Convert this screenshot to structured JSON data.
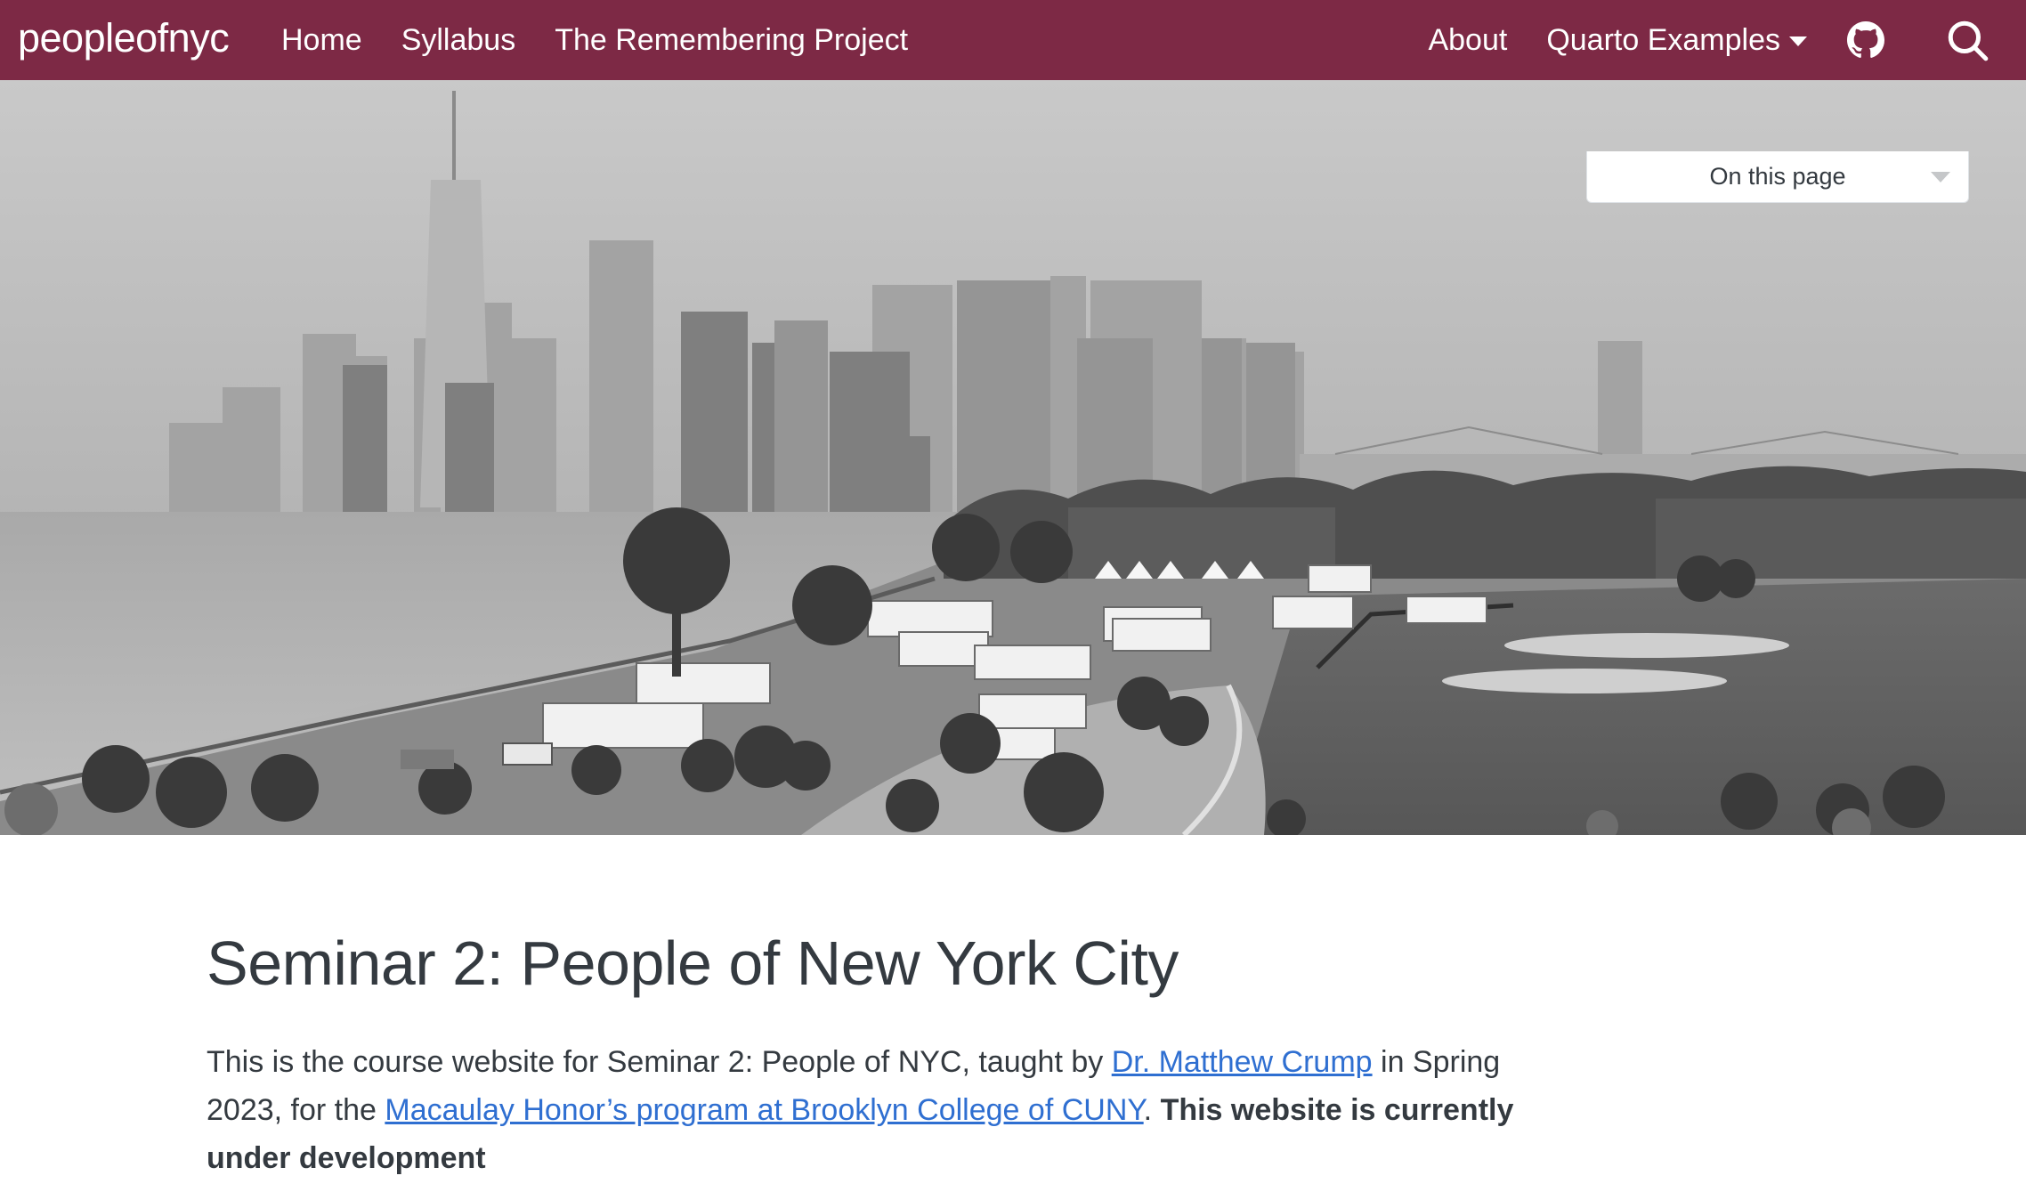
{
  "navbar": {
    "brand": "peopleofnyc",
    "left_links": [
      {
        "label": "Home"
      },
      {
        "label": "Syllabus"
      },
      {
        "label": "The Remembering Project"
      }
    ],
    "about_label": "About",
    "dropdown_label": "Quarto Examples",
    "github_icon": "github-icon",
    "search_icon": "search-icon"
  },
  "toc": {
    "label": "On this page"
  },
  "hero": {
    "alt_description": "Black and white photo of the Lower Manhattan skyline seen across the water from Governors Island"
  },
  "main": {
    "title": "Seminar 2: People of New York City",
    "intro": {
      "text_1": "This is the course website for Seminar 2: People of NYC, taught by ",
      "link_1": "Dr. Matthew Crump",
      "text_2": " in Spring 2023, for the ",
      "link_2": "Macaulay Honor’s program at Brooklyn College of CUNY",
      "text_3": ". ",
      "bold": "This website is currently under development"
    }
  },
  "colors": {
    "navbar_bg": "#7d2945",
    "link": "#2f6fd1",
    "text": "#343a40"
  }
}
